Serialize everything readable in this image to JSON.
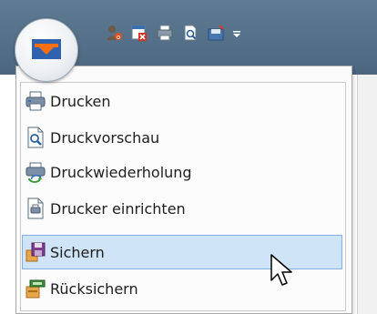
{
  "window": {
    "titlebar_color": "#5a7890",
    "app_button_icon": "bank-logo-icon"
  },
  "quick_access_toolbar": {
    "icons": [
      "user-alert-icon",
      "delete-document-icon",
      "printer-icon",
      "print-preview-icon",
      "save-disk-icon",
      "dropdown-arrow-icon"
    ]
  },
  "menu": {
    "items": [
      {
        "label": "Drucken",
        "icon": "printer-icon"
      },
      {
        "label": "Druckvorschau",
        "icon": "print-preview-icon"
      },
      {
        "label": "Druckwiederholung",
        "icon": "print-repeat-icon"
      },
      {
        "label": "Drucker einrichten",
        "icon": "printer-setup-icon"
      },
      {
        "label": "Sichern",
        "icon": "save-backup-icon",
        "selected": true
      },
      {
        "label": "Rücksichern",
        "icon": "restore-icon"
      }
    ],
    "selected_color": "#cfe4f7"
  }
}
